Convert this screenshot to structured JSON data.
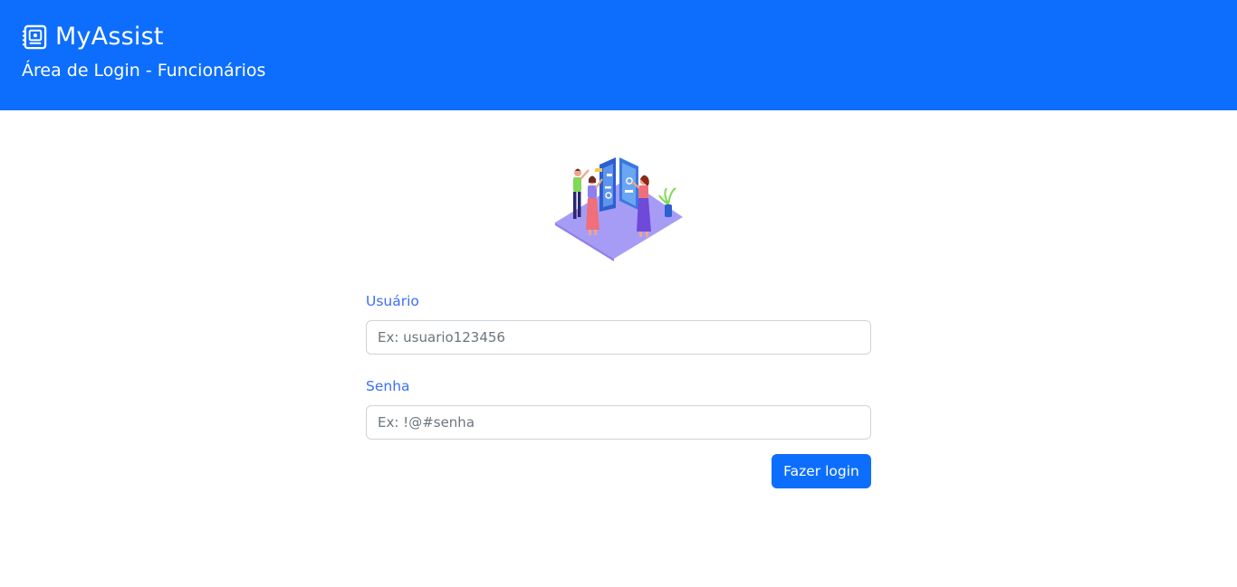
{
  "header": {
    "brand_icon": "assistant-document-icon",
    "app_name": "MyAssist",
    "subtitle": "Área de Login - Funcionários",
    "background_color": "#0d6efd"
  },
  "illustration": {
    "icon": "team-collaboration-illustration"
  },
  "login_form": {
    "username_label": "Usuário",
    "username_placeholder": "Ex: usuario123456",
    "username_value": "",
    "password_label": "Senha",
    "password_placeholder": "Ex: !@#senha",
    "password_value": "",
    "submit_label": "Fazer login",
    "accent_color": "#0d6efd",
    "label_color": "#3b6ef6"
  }
}
